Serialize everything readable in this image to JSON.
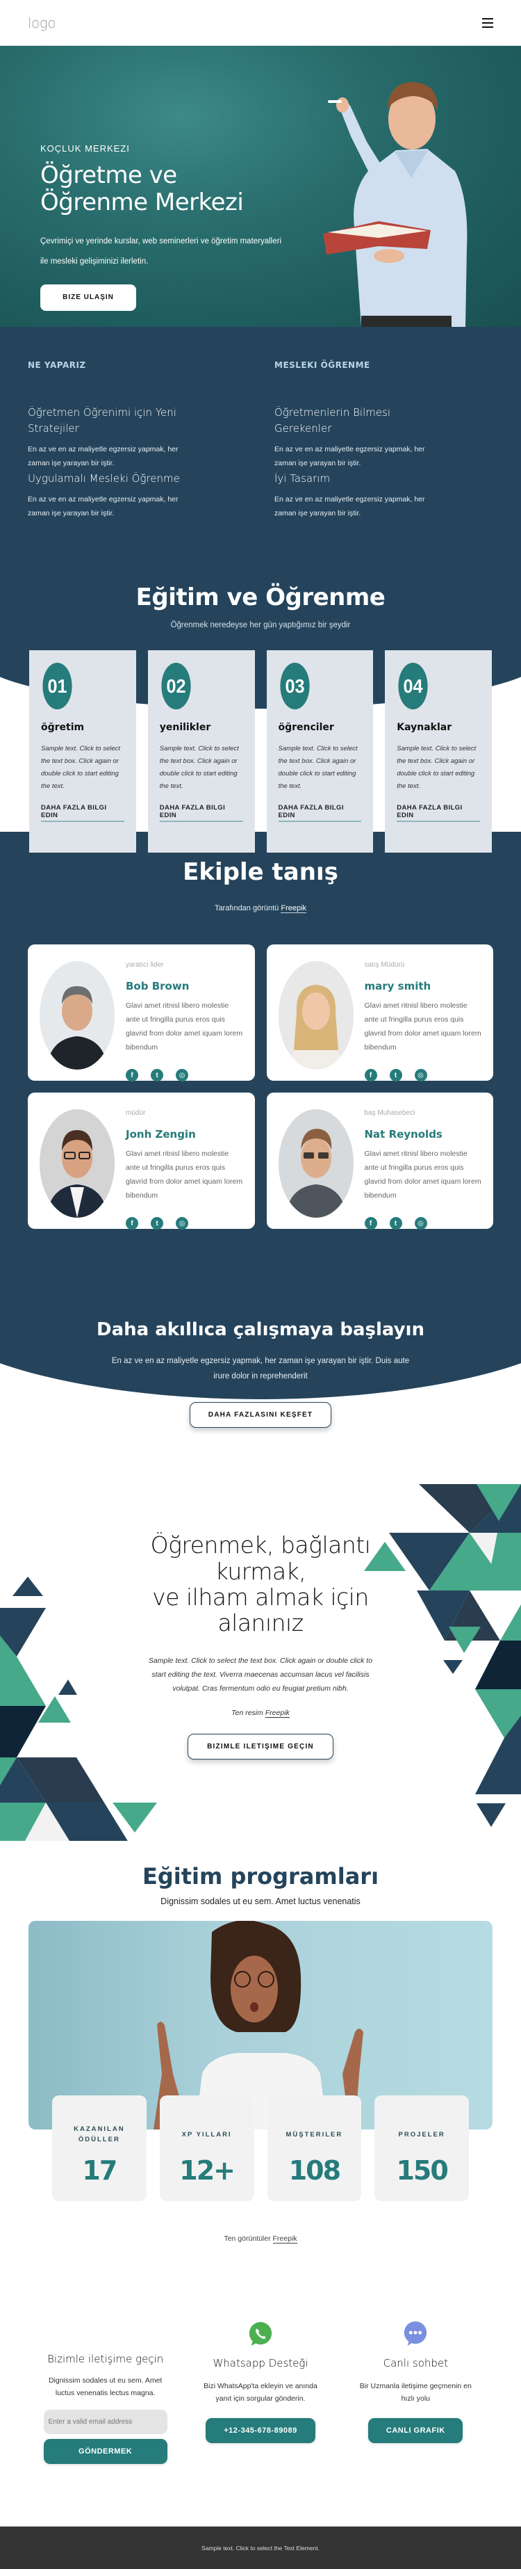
{
  "header": {
    "logo": "logo",
    "menu_icon": "hamburger-icon"
  },
  "hero": {
    "kicker": "KOÇLUK MERKEZI",
    "title_line1": "Öğretme ve",
    "title_line2": "Öğrenme Merkezi",
    "description": "Çevrimiçi ve yerinde kurslar, web seminerleri ve öğretim materyalleri ile mesleki gelişiminizi ilerletin.",
    "cta": "BIZE ULAŞIN"
  },
  "what": {
    "columns": [
      {
        "heading": "NE YAPARIZ",
        "items": [
          {
            "title": "Öğretmen Öğrenimi için Yeni Stratejiler",
            "text": "En az ve en az maliyetle egzersiz yapmak, her zaman işe yarayan bir iştir."
          },
          {
            "title": "Uygulamalı Mesleki Öğrenme",
            "text": "En az ve en az maliyetle egzersiz yapmak, her zaman işe yarayan bir iştir."
          }
        ]
      },
      {
        "heading": "MESLEKI ÖĞRENME",
        "items": [
          {
            "title": "Öğretmenlerin Bilmesi Gerekenler",
            "text": "En az ve en az maliyetle egzersiz yapmak, her zaman işe yarayan bir iştir."
          },
          {
            "title": "İyi Tasarım",
            "text": "En az ve en az maliyetle egzersiz yapmak, her zaman işe yarayan bir iştir."
          }
        ]
      }
    ]
  },
  "education": {
    "title": "Eğitim ve Öğrenme",
    "subtitle": "Öğrenmek neredeyse her gün yaptığımız bir şeydir",
    "cards": [
      {
        "num": "01",
        "title": "öğretim",
        "text": "Sample text. Click to select the text box. Click again or double click to start editing the text.",
        "link": "DAHA FAZLA BILGI EDIN"
      },
      {
        "num": "02",
        "title": "yenilikler",
        "text": "Sample text. Click to select the text box. Click again or double click to start editing the text.",
        "link": "DAHA FAZLA BILGI EDIN"
      },
      {
        "num": "03",
        "title": "öğrenciler",
        "text": "Sample text. Click to select the text box. Click again or double click to start editing the text.",
        "link": "DAHA FAZLA BILGI EDIN"
      },
      {
        "num": "04",
        "title": "Kaynaklar",
        "text": "Sample text. Click to select the text box. Click again or double click to start editing the text.",
        "link": "DAHA FAZLA BILGI EDIN"
      }
    ]
  },
  "team": {
    "title": "Ekiple tanış",
    "credit_prefix": "Tarafından görüntü",
    "credit_link": "Freepik",
    "members": [
      {
        "role": "yaratıcı lider",
        "name": "Bob Brown",
        "bio": "Glavi amet ritnisl libero molestie ante ut fringilla purus eros quis glavrid from dolor amet iquam lorem bibendum"
      },
      {
        "role": "satış Müdürü",
        "name": "mary smith",
        "bio": "Glavi amet ritnisl libero molestie ante ut fringilla purus eros quis glavrid from dolor amet iquam lorem bibendum"
      },
      {
        "role": "müdür",
        "name": "Jonh Zengin",
        "bio": "Glavi amet ritnisl libero molestie ante ut fringilla purus eros quis glavrid from dolor amet iquam lorem bibendum"
      },
      {
        "role": "baş Muhasebeci",
        "name": "Nat Reynolds",
        "bio": "Glavi amet ritnisl libero molestie ante ut fringilla purus eros quis glavrid from dolor amet iquam lorem bibendum"
      }
    ],
    "social": [
      "f",
      "t",
      "◎"
    ]
  },
  "smart": {
    "title": "Daha akıllıca çalışmaya başlayın",
    "text": "En az ve en az maliyetle egzersiz yapmak, her zaman işe yarayan bir iştir. Duis aute irure dolor in reprehenderit",
    "cta": "DAHA FAZLASINI KEŞFET"
  },
  "inspire": {
    "title_line1": "Öğrenmek, bağlantı",
    "title_line2": "kurmak,",
    "title_line3": "ve ilham almak için",
    "title_line4": "alanınız",
    "text": "Sample text. Click to select the text box. Click again or double click to start editing the text. Viverra maecenas accumsan lacus vel facilisis volutpat. Cras fermentum odio eu feugiat pretium nibh.",
    "credit_prefix": "Ten resim",
    "credit_link": "Freepik",
    "cta": "BIZIMLE ILETIŞIME GEÇIN"
  },
  "programs": {
    "title": "Eğitim programları",
    "subtitle": "Dignissim sodales ut eu sem. Amet luctus venenatis",
    "stats": [
      {
        "label": "KAZANILAN ÖDÜLLER",
        "value": "17"
      },
      {
        "label": "XP YILLARI",
        "value": "12+"
      },
      {
        "label": "MÜŞTERILER",
        "value": "108"
      },
      {
        "label": "PROJELER",
        "value": "150"
      }
    ],
    "credit_prefix": "Ten görüntüler",
    "credit_link": "Freepik"
  },
  "contact": {
    "form": {
      "title": "Bizimle iletişime geçin",
      "text": "Dignissim sodales ut eu sem. Amet luctus venenatis lectus magna.",
      "email_placeholder": "Enter a valid email address",
      "submit": "GÖNDERMEK"
    },
    "whatsapp": {
      "title": "Whatsapp Desteği",
      "text": "Bizi WhatsApp'ta ekleyin ve anında yanıt için sorgular gönderin.",
      "cta": "+12-345-678-89089",
      "color": "#4caf50"
    },
    "chat": {
      "title": "Canlı sohbet",
      "text": "Bir Uzmanla iletişime geçmenin en hızlı yolu",
      "cta": "CANLI GRAFIK",
      "color": "#7b8fe0"
    }
  },
  "footer": {
    "text": "Sample text. Click to select the Text Element."
  },
  "colors": {
    "navy": "#25445c",
    "teal": "#267b7b",
    "mint": "#45a98a",
    "card_gray": "#dfe4ea"
  }
}
